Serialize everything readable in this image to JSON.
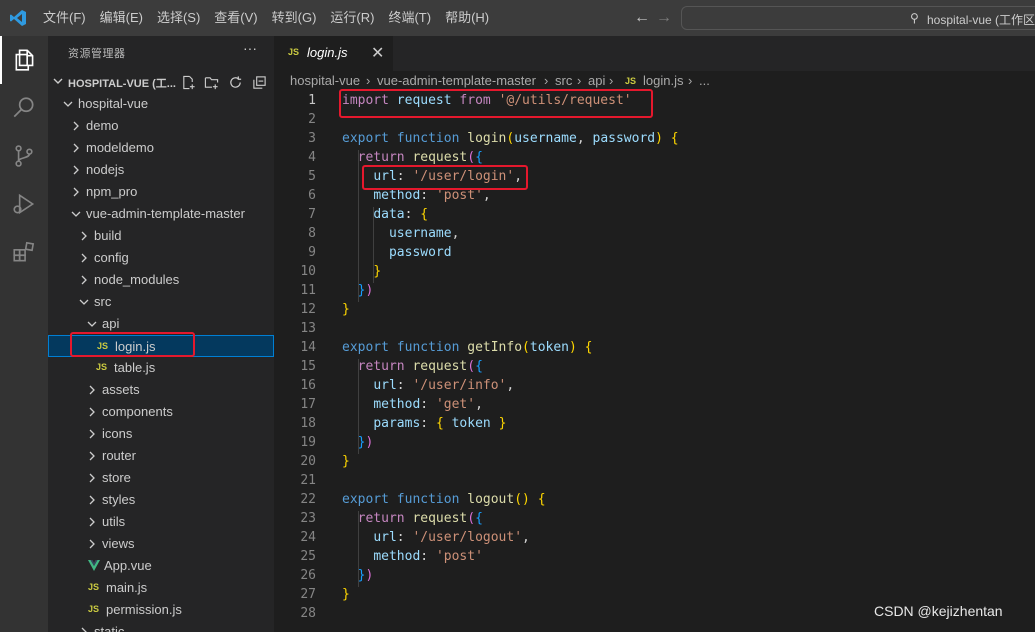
{
  "menu": [
    "文件(F)",
    "编辑(E)",
    "选择(S)",
    "查看(V)",
    "转到(G)",
    "运行(R)",
    "终端(T)",
    "帮助(H)"
  ],
  "command_center": {
    "text": "hospital-vue (工作区"
  },
  "sidebar": {
    "header": "资源管理器",
    "more": "···",
    "workspace_title": "HOSPITAL-VUE (工...",
    "tree": [
      {
        "label": "hospital-vue",
        "type": "folder",
        "expanded": true,
        "depth": 1
      },
      {
        "label": "demo",
        "type": "folder",
        "expanded": false,
        "depth": 2
      },
      {
        "label": "modeldemo",
        "type": "folder",
        "expanded": false,
        "depth": 2
      },
      {
        "label": "nodejs",
        "type": "folder",
        "expanded": false,
        "depth": 2
      },
      {
        "label": "npm_pro",
        "type": "folder",
        "expanded": false,
        "depth": 2
      },
      {
        "label": "vue-admin-template-master",
        "type": "folder",
        "expanded": true,
        "depth": 2
      },
      {
        "label": "build",
        "type": "folder",
        "expanded": false,
        "depth": 3
      },
      {
        "label": "config",
        "type": "folder",
        "expanded": false,
        "depth": 3
      },
      {
        "label": "node_modules",
        "type": "folder",
        "expanded": false,
        "depth": 3
      },
      {
        "label": "src",
        "type": "folder",
        "expanded": true,
        "depth": 3
      },
      {
        "label": "api",
        "type": "folder",
        "expanded": true,
        "depth": 4
      },
      {
        "label": "login.js",
        "type": "js",
        "depth": 5,
        "selected": true
      },
      {
        "label": "table.js",
        "type": "js",
        "depth": 5
      },
      {
        "label": "assets",
        "type": "folder",
        "expanded": false,
        "depth": 4
      },
      {
        "label": "components",
        "type": "folder",
        "expanded": false,
        "depth": 4
      },
      {
        "label": "icons",
        "type": "folder",
        "expanded": false,
        "depth": 4
      },
      {
        "label": "router",
        "type": "folder",
        "expanded": false,
        "depth": 4
      },
      {
        "label": "store",
        "type": "folder",
        "expanded": false,
        "depth": 4
      },
      {
        "label": "styles",
        "type": "folder",
        "expanded": false,
        "depth": 4
      },
      {
        "label": "utils",
        "type": "folder",
        "expanded": false,
        "depth": 4
      },
      {
        "label": "views",
        "type": "folder",
        "expanded": false,
        "depth": 4
      },
      {
        "label": "App.vue",
        "type": "vue",
        "depth": 4
      },
      {
        "label": "main.js",
        "type": "js",
        "depth": 4
      },
      {
        "label": "permission.js",
        "type": "js",
        "depth": 4
      },
      {
        "label": "static",
        "type": "folder",
        "expanded": false,
        "depth": 3
      }
    ]
  },
  "tab": {
    "label": "login.js",
    "badge": "JS",
    "close": "✕"
  },
  "breadcrumbs": [
    "hospital-vue",
    "vue-admin-template-master",
    "src",
    "api",
    "login.js",
    "..."
  ],
  "line_numbers": [
    "1",
    "2",
    "3",
    "4",
    "5",
    "6",
    "7",
    "8",
    "9",
    "10",
    "11",
    "12",
    "13",
    "14",
    "15",
    "16",
    "17",
    "18",
    "19",
    "20",
    "21",
    "22",
    "23",
    "24",
    "25",
    "26",
    "27",
    "28"
  ],
  "code": [
    [
      [
        "k",
        "import"
      ],
      [
        "p",
        " "
      ],
      [
        "v",
        "request"
      ],
      [
        "p",
        " "
      ],
      [
        "k",
        "from"
      ],
      [
        "p",
        " "
      ],
      [
        "s",
        "'@/utils/request'"
      ]
    ],
    [],
    [
      [
        "kb",
        "export"
      ],
      [
        "p",
        " "
      ],
      [
        "kb",
        "function"
      ],
      [
        "p",
        " "
      ],
      [
        "fn",
        "login"
      ],
      [
        "b1",
        "("
      ],
      [
        "v",
        "username"
      ],
      [
        "p",
        ", "
      ],
      [
        "v",
        "password"
      ],
      [
        "b1",
        ")"
      ],
      [
        "p",
        " "
      ],
      [
        "b1",
        "{"
      ]
    ],
    [
      [
        "p",
        "  "
      ],
      [
        "k",
        "return"
      ],
      [
        "p",
        " "
      ],
      [
        "fn",
        "request"
      ],
      [
        "b2",
        "("
      ],
      [
        "b3",
        "{"
      ]
    ],
    [
      [
        "p",
        "    "
      ],
      [
        "v",
        "url"
      ],
      [
        "p",
        ": "
      ],
      [
        "s",
        "'/user/login'"
      ],
      [
        "p",
        ","
      ]
    ],
    [
      [
        "p",
        "    "
      ],
      [
        "v",
        "method"
      ],
      [
        "p",
        ": "
      ],
      [
        "s",
        "'post'"
      ],
      [
        "p",
        ","
      ]
    ],
    [
      [
        "p",
        "    "
      ],
      [
        "v",
        "data"
      ],
      [
        "p",
        ": "
      ],
      [
        "b1",
        "{"
      ]
    ],
    [
      [
        "p",
        "      "
      ],
      [
        "v",
        "username"
      ],
      [
        "p",
        ","
      ]
    ],
    [
      [
        "p",
        "      "
      ],
      [
        "v",
        "password"
      ]
    ],
    [
      [
        "p",
        "    "
      ],
      [
        "b1",
        "}"
      ]
    ],
    [
      [
        "p",
        "  "
      ],
      [
        "b3",
        "}"
      ],
      [
        "b2",
        ")"
      ]
    ],
    [
      [
        "b1",
        "}"
      ]
    ],
    [],
    [
      [
        "kb",
        "export"
      ],
      [
        "p",
        " "
      ],
      [
        "kb",
        "function"
      ],
      [
        "p",
        " "
      ],
      [
        "fn",
        "getInfo"
      ],
      [
        "b1",
        "("
      ],
      [
        "v",
        "token"
      ],
      [
        "b1",
        ")"
      ],
      [
        "p",
        " "
      ],
      [
        "b1",
        "{"
      ]
    ],
    [
      [
        "p",
        "  "
      ],
      [
        "k",
        "return"
      ],
      [
        "p",
        " "
      ],
      [
        "fn",
        "request"
      ],
      [
        "b2",
        "("
      ],
      [
        "b3",
        "{"
      ]
    ],
    [
      [
        "p",
        "    "
      ],
      [
        "v",
        "url"
      ],
      [
        "p",
        ": "
      ],
      [
        "s",
        "'/user/info'"
      ],
      [
        "p",
        ","
      ]
    ],
    [
      [
        "p",
        "    "
      ],
      [
        "v",
        "method"
      ],
      [
        "p",
        ": "
      ],
      [
        "s",
        "'get'"
      ],
      [
        "p",
        ","
      ]
    ],
    [
      [
        "p",
        "    "
      ],
      [
        "v",
        "params"
      ],
      [
        "p",
        ": "
      ],
      [
        "b1",
        "{"
      ],
      [
        "p",
        " "
      ],
      [
        "v",
        "token"
      ],
      [
        "p",
        " "
      ],
      [
        "b1",
        "}"
      ]
    ],
    [
      [
        "p",
        "  "
      ],
      [
        "b3",
        "}"
      ],
      [
        "b2",
        ")"
      ]
    ],
    [
      [
        "b1",
        "}"
      ]
    ],
    [],
    [
      [
        "kb",
        "export"
      ],
      [
        "p",
        " "
      ],
      [
        "kb",
        "function"
      ],
      [
        "p",
        " "
      ],
      [
        "fn",
        "logout"
      ],
      [
        "b1",
        "()"
      ],
      [
        "p",
        " "
      ],
      [
        "b1",
        "{"
      ]
    ],
    [
      [
        "p",
        "  "
      ],
      [
        "k",
        "return"
      ],
      [
        "p",
        " "
      ],
      [
        "fn",
        "request"
      ],
      [
        "b2",
        "("
      ],
      [
        "b3",
        "{"
      ]
    ],
    [
      [
        "p",
        "    "
      ],
      [
        "v",
        "url"
      ],
      [
        "p",
        ": "
      ],
      [
        "s",
        "'/user/logout'"
      ],
      [
        "p",
        ","
      ]
    ],
    [
      [
        "p",
        "    "
      ],
      [
        "v",
        "method"
      ],
      [
        "p",
        ": "
      ],
      [
        "s",
        "'post'"
      ]
    ],
    [
      [
        "p",
        "  "
      ],
      [
        "b3",
        "}"
      ],
      [
        "b2",
        ")"
      ]
    ],
    [
      [
        "b1",
        "}"
      ]
    ],
    []
  ],
  "watermark": "CSDN @kejizhentan",
  "colors": {
    "highlight_box": "#e5182d",
    "js_badge": "#cbcb41",
    "vue_badge": "#41b883",
    "selection": "#04395e"
  }
}
